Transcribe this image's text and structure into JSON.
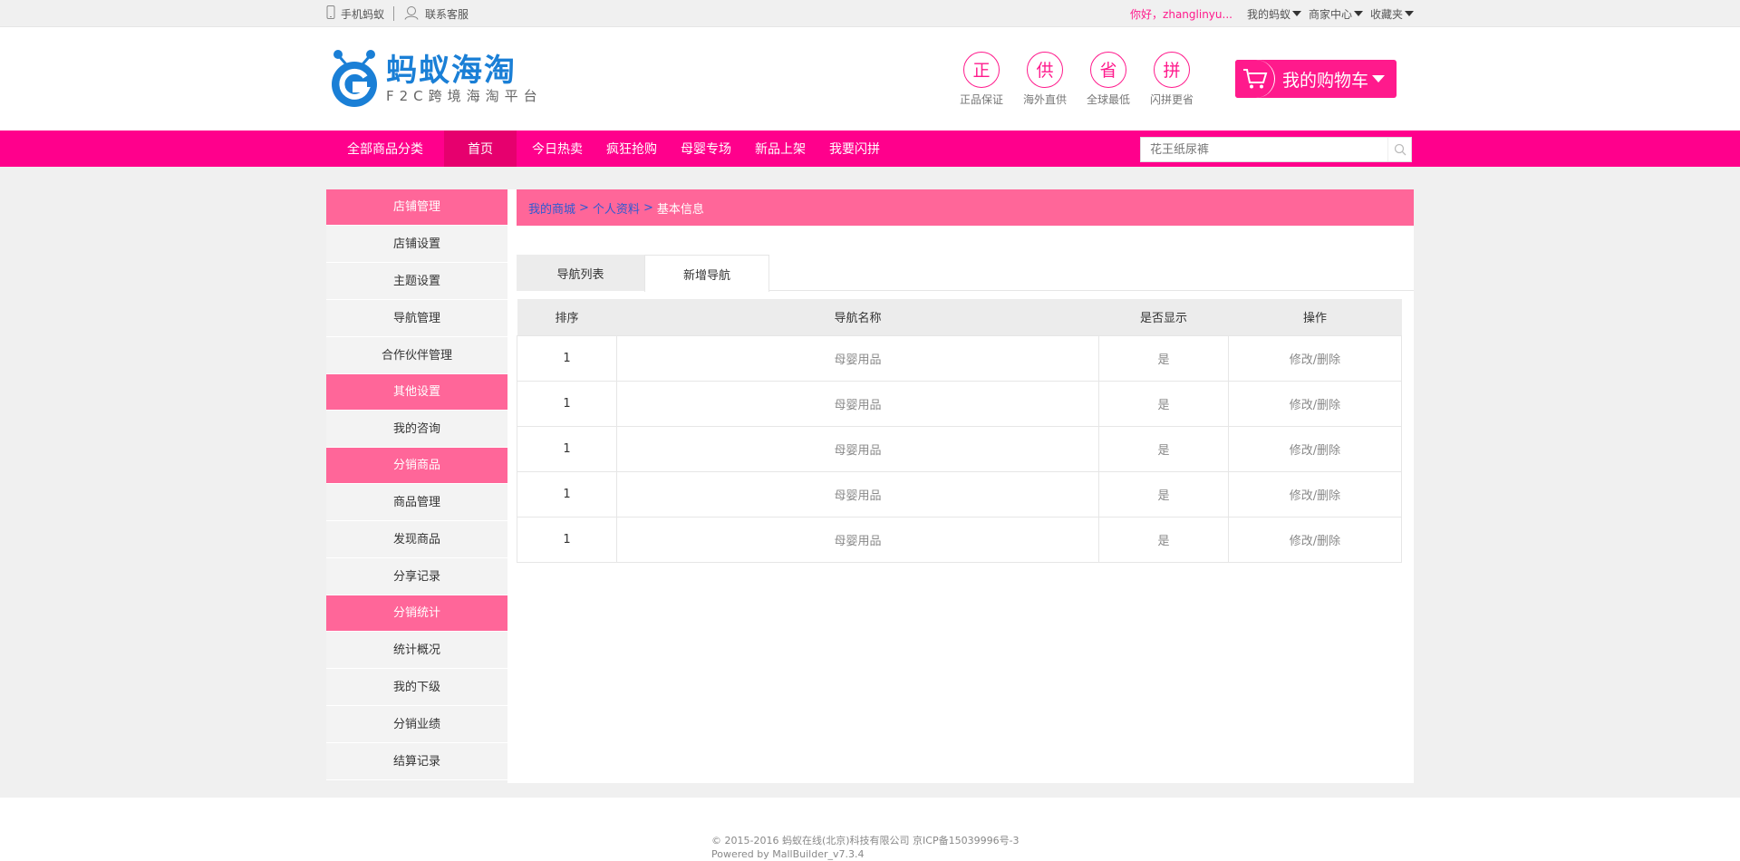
{
  "topbar": {
    "mobile_label": "手机蚂蚁",
    "service_label": "联系客服",
    "greeting": "你好，zhanglinyu...",
    "menus": [
      "我的蚂蚁",
      "商家中心",
      "收藏夹"
    ]
  },
  "header": {
    "logo_name": "蚂蚁海淘",
    "logo_sub": "F2C跨境海淘平台",
    "badges": [
      {
        "char": "正",
        "label": "正品保证"
      },
      {
        "char": "供",
        "label": "海外直供"
      },
      {
        "char": "省",
        "label": "全球最低"
      },
      {
        "char": "拼",
        "label": "闪拼更省"
      }
    ],
    "cart_label": "我的购物车"
  },
  "nav": {
    "all_label": "全部商品分类",
    "items": [
      "首页",
      "今日热卖",
      "疯狂抢购",
      "母婴专场",
      "新品上架",
      "我要闪拼"
    ],
    "search_placeholder": "花王纸尿裤"
  },
  "sidebar": {
    "groups": [
      {
        "title": "店铺管理",
        "items": [
          "店铺设置",
          "主题设置",
          "导航管理",
          "合作伙伴管理"
        ]
      },
      {
        "title": "其他设置",
        "items": [
          "我的咨询"
        ]
      },
      {
        "title": "分销商品",
        "items": [
          "商品管理",
          "发现商品",
          "分享记录"
        ]
      },
      {
        "title": "分销统计",
        "items": [
          "统计概况",
          "我的下级",
          "分销业绩",
          "结算记录"
        ]
      }
    ]
  },
  "breadcrumb": {
    "link1": "我的商城",
    "link2": "个人资料",
    "sep": ">",
    "current": "基本信息"
  },
  "tabs": [
    "导航列表",
    "新增导航"
  ],
  "table": {
    "headers": [
      "排序",
      "导航名称",
      "是否显示",
      "操作"
    ],
    "rows": [
      [
        "1",
        "母婴用品",
        "是",
        "修改/删除"
      ],
      [
        "1",
        "母婴用品",
        "是",
        "修改/删除"
      ],
      [
        "1",
        "母婴用品",
        "是",
        "修改/删除"
      ],
      [
        "1",
        "母婴用品",
        "是",
        "修改/删除"
      ],
      [
        "1",
        "母婴用品",
        "是",
        "修改/删除"
      ]
    ]
  },
  "footer": {
    "line1": "© 2015-2016 蚂蚁在线(北京)科技有限公司 京ICP备15039996号-3",
    "line2": "Powered by MallBuilder_v7.3.4"
  },
  "colors": {
    "brand_pink": "#ff008c",
    "sidebar_group": "#ff6699",
    "logo_blue": "#1a7fd6"
  }
}
